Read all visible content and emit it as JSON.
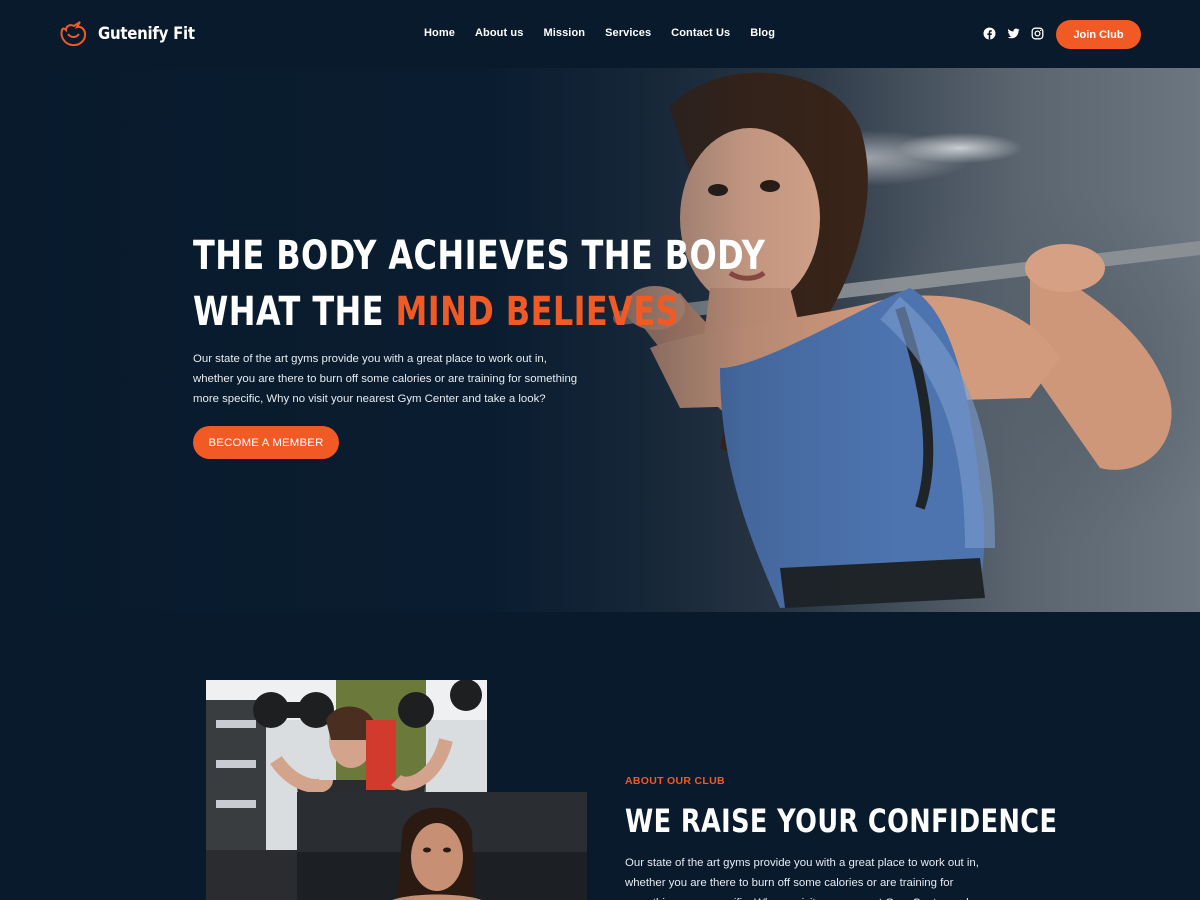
{
  "brand": {
    "name": "Gutenify Fit",
    "accent": "#f15a24",
    "background": "#081a2c"
  },
  "nav": {
    "items": [
      "Home",
      "About us",
      "Mission",
      "Services",
      "Contact Us",
      "Blog"
    ]
  },
  "social": {
    "icons": [
      "facebook-icon",
      "twitter-icon",
      "instagram-icon"
    ]
  },
  "header": {
    "join_label": "Join Club"
  },
  "hero": {
    "title_line1": "THE BODY ACHIEVES THE BODY",
    "title_line2_prefix": "WHAT THE ",
    "title_line2_accent": "MIND BELIEVES",
    "description": "Our state of the art gyms provide you with a great place to work out in, whether you are there to burn off some calories or are training for something more specific, Why no visit your nearest Gym Center and take a look?",
    "cta_label": "BECOME A MEMBER"
  },
  "about": {
    "label": "ABOUT OUR CLUB",
    "title": "WE RAISE YOUR CONFIDENCE",
    "description": "Our state of the art gyms provide you with a great place to work out in, whether you are there to burn off some calories or are training for something more specific, Why no visit your nearest Gym Center and take a look?"
  }
}
